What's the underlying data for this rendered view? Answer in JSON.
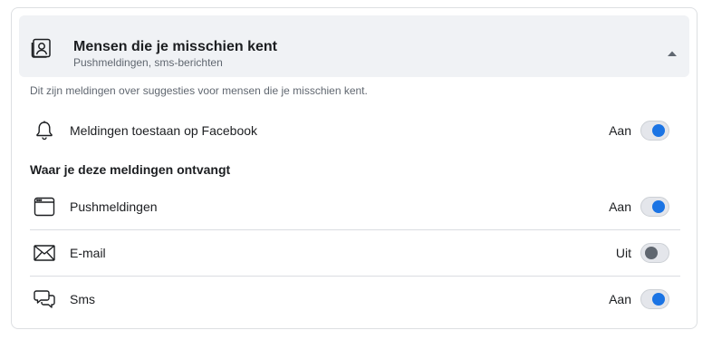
{
  "header": {
    "title": "Mensen die je misschien kent",
    "subtitle": "Pushmeldingen, sms-berichten",
    "icon": "person-card-icon",
    "collapse_icon": "caret-up-icon"
  },
  "description": "Dit zijn meldingen over suggesties voor mensen die je misschien kent.",
  "allow_row": {
    "icon": "bell-icon",
    "label": "Meldingen toestaan op Facebook",
    "state": "Aan",
    "enabled": true
  },
  "section_heading": "Waar je deze meldingen ontvangt",
  "channels": [
    {
      "icon": "browser-window-icon",
      "label": "Pushmeldingen",
      "state": "Aan",
      "enabled": true
    },
    {
      "icon": "envelope-icon",
      "label": "E-mail",
      "state": "Uit",
      "enabled": false
    },
    {
      "icon": "chat-bubbles-icon",
      "label": "Sms",
      "state": "Aan",
      "enabled": true
    }
  ],
  "colors": {
    "toggle_on": "#1b74e4",
    "toggle_off_knob": "#606770",
    "header_bg": "#f0f2f5"
  }
}
